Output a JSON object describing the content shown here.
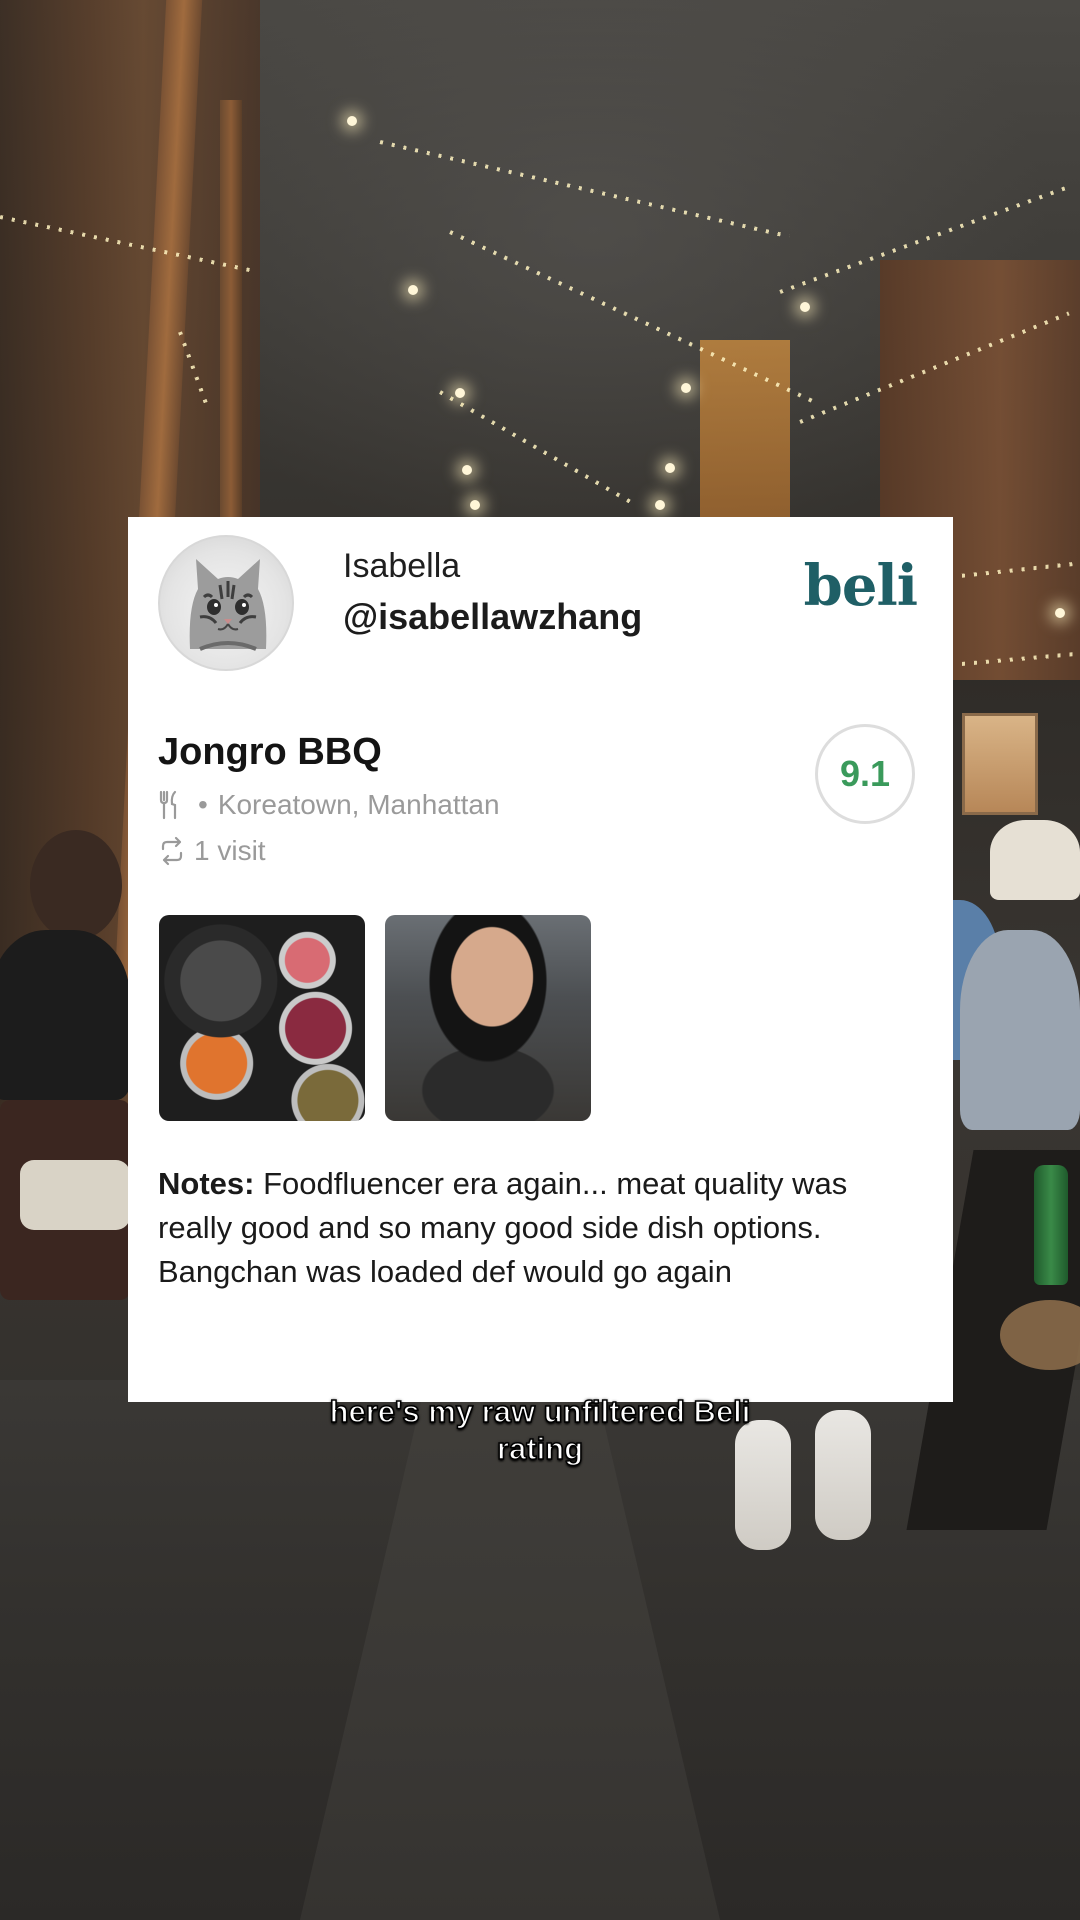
{
  "user": {
    "display_name": "Isabella",
    "handle": "@isabellawzhang",
    "avatar": "cat-avatar"
  },
  "brand": {
    "logo_text": "beli",
    "color": "#1f5f66"
  },
  "restaurant": {
    "name": "Jongro BBQ",
    "category_icon": "fork-knife-icon",
    "location": "Koreatown, Manhattan",
    "visits_icon": "repeat-icon",
    "visits": "1 visit",
    "score": "9.1",
    "score_color": "#3a9a5b"
  },
  "photos": [
    {
      "name": "kbbq-grill-table-photo"
    },
    {
      "name": "diner-eating-photo"
    }
  ],
  "notes": {
    "label": "Notes:",
    "text": " Foodfluencer era again... meat quality was really good and so many good side dish options. Bangchan was loaded def would go again"
  },
  "caption": {
    "line1": "here's my raw unfiltered Beli",
    "line2": "rating"
  }
}
